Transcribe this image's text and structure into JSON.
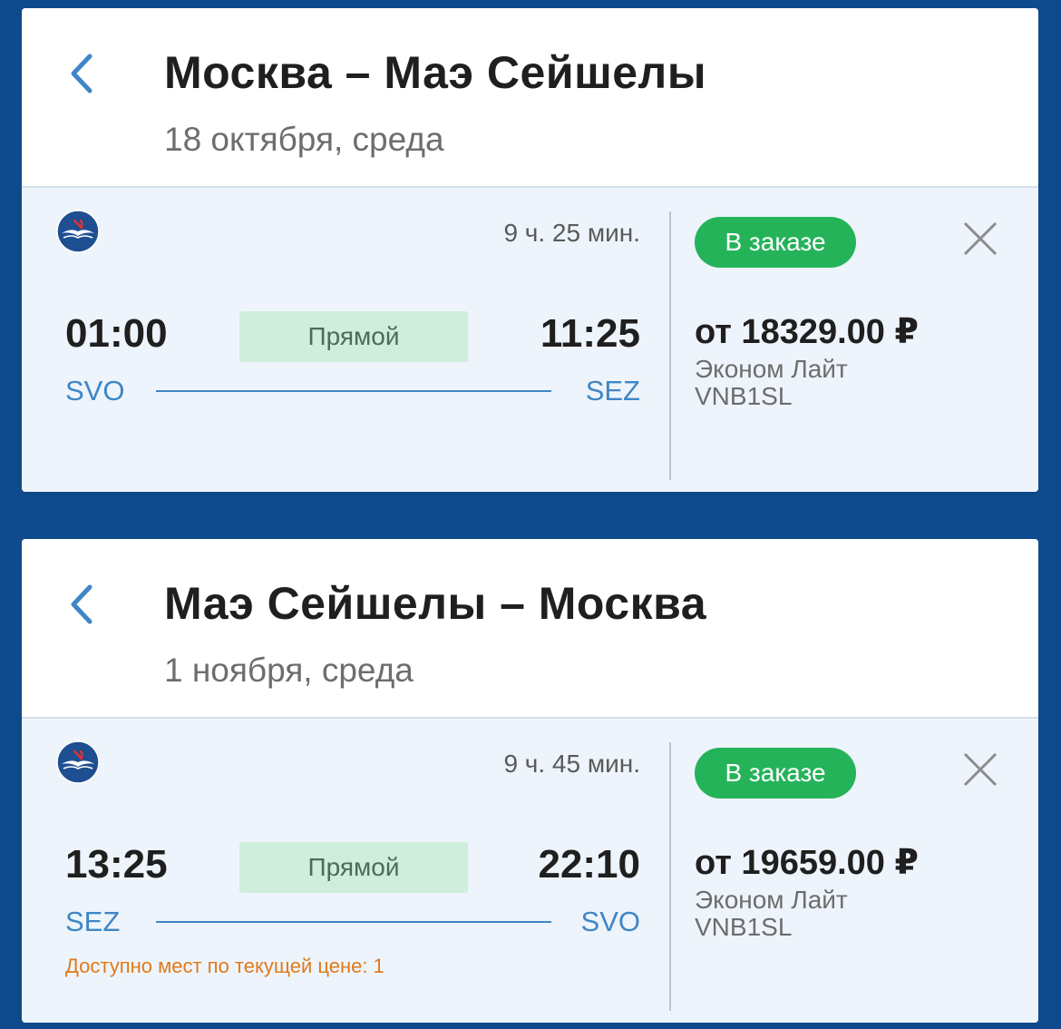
{
  "colors": {
    "page_background": "#0f4a8c",
    "accent_blue": "#3f86c6",
    "status_green": "#25b35a",
    "direct_badge_bg": "#cfeedb",
    "warning_orange": "#e07a1a"
  },
  "itineraries": [
    {
      "title": "Москва – Маэ Сейшелы",
      "date": "18 октября, среда",
      "back_icon": "chevron-left-icon",
      "flight": {
        "airline_logo": "aeroflot-logo",
        "duration": "9 ч. 25 мин.",
        "departure_time": "01:00",
        "arrival_time": "11:25",
        "stops_label": "Прямой",
        "from_code": "SVO",
        "to_code": "SEZ",
        "seats_note": "",
        "status": "В заказе",
        "price": "от 18329.00 ₽",
        "fare_class": "Эконом Лайт",
        "fare_code": "VNB1SL",
        "close_icon": "close-icon"
      }
    },
    {
      "title": "Маэ Сейшелы – Москва",
      "date": "1 ноября, среда",
      "back_icon": "chevron-left-icon",
      "flight": {
        "airline_logo": "aeroflot-logo",
        "duration": "9 ч. 45 мин.",
        "departure_time": "13:25",
        "arrival_time": "22:10",
        "stops_label": "Прямой",
        "from_code": "SEZ",
        "to_code": "SVO",
        "seats_note": "Доступно мест по текущей цене: 1",
        "status": "В заказе",
        "price": "от 19659.00 ₽",
        "fare_class": "Эконом Лайт",
        "fare_code": "VNB1SL",
        "close_icon": "close-icon"
      }
    }
  ]
}
